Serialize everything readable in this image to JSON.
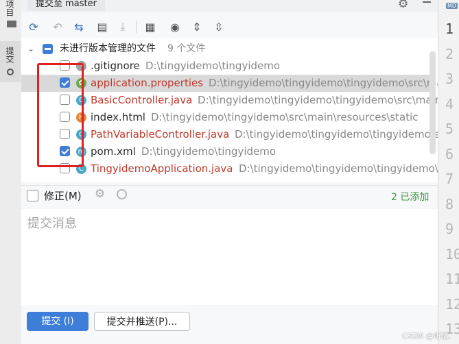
{
  "left_strip": {
    "project_label": "项目",
    "commit_label": "提交"
  },
  "tab": {
    "title": "提交至 master"
  },
  "toolbar": {
    "icons": [
      "refresh-icon",
      "rollback-icon",
      "diff-icon",
      "changelist-icon",
      "shelve-icon",
      "group-by-icon",
      "view-options-icon",
      "expand-all-icon",
      "collapse-all-icon"
    ]
  },
  "changes": {
    "group_label": "未进行版本管理的文件",
    "group_count": "9 个文件",
    "files": [
      {
        "name": ".gitignore",
        "path": "D:\\tingyidemo\\tingyidemo",
        "checked": false,
        "state": "normal",
        "icon_color": "#9aa0a6",
        "icon_glyph": "·"
      },
      {
        "name": "application.properties",
        "path": "D:\\tingyidemo\\tingyidemo\\tingyidemo\\src\\main\\resources",
        "checked": true,
        "state": "modified",
        "icon_color": "#6aa84f",
        "icon_glyph": "✿"
      },
      {
        "name": "BasicController.java",
        "path": "D:\\tingyidemo\\tingyidemo\\tingyidemo\\src\\main\\java\\com\\tin",
        "checked": false,
        "state": "modified",
        "icon_color": "#4aa7c9",
        "icon_glyph": "C"
      },
      {
        "name": "index.html",
        "path": "D:\\tingyidemo\\tingyidemo\\src\\main\\resources\\static",
        "checked": false,
        "state": "normal",
        "icon_color": "#e0883a",
        "icon_glyph": "H"
      },
      {
        "name": "PathVariableController.java",
        "path": "D:\\tingyidemo\\tingyidemo\\tingyidemo\\src\\main\\java\\",
        "checked": false,
        "state": "modified",
        "icon_color": "#4aa7c9",
        "icon_glyph": "C"
      },
      {
        "name": "pom.xml",
        "path": "D:\\tingyidemo\\tingyidemo",
        "checked": true,
        "state": "normal",
        "icon_color": "#4aa7c9",
        "icon_glyph": "m"
      },
      {
        "name": "TingyidemoApplication.java",
        "path": "D:\\tingyidemo\\tingyidemo\\tingyidemo\\src\\main\\java",
        "checked": false,
        "state": "modified",
        "icon_color": "#4aa7c9",
        "icon_glyph": "C"
      }
    ]
  },
  "amend": {
    "label": "修正(M)",
    "added_status": "2 已添加"
  },
  "message": {
    "placeholder": "提交消息"
  },
  "buttons": {
    "commit": "提交 (I)",
    "commit_push": "提交并推送(P)..."
  },
  "gutter": {
    "badge": "MD",
    "line_numbers": [
      "1",
      "2",
      "3",
      "4",
      "5",
      "6",
      "7",
      "8",
      "9",
      "10",
      "11",
      "12",
      "13"
    ]
  },
  "watermark": "CSDN @听忆.",
  "colors": {
    "accent": "#3e7ed8",
    "modified": "#c0392b",
    "added": "#3a9a3a"
  }
}
